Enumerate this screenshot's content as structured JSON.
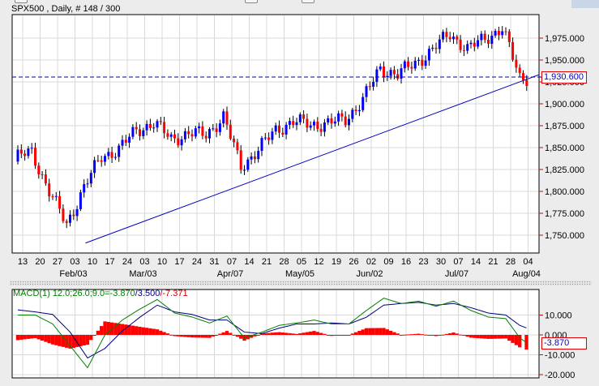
{
  "title": "SPX500 , Daily, # 148 / 300",
  "colors": {
    "up": "#0000ff",
    "down": "#ff0000",
    "macd": "#008000",
    "signal": "#000080",
    "histogram": "#ff0000",
    "trendline": "#0000c0"
  },
  "chart_data": [
    {
      "type": "candlestick",
      "symbol": "SPX500",
      "timeframe": "Daily",
      "ylim": [
        1729,
        2002
      ],
      "y_ticks": [
        "1,975.000",
        "1,950.000",
        "1,925.000",
        "1,900.000",
        "1,875.000",
        "1,850.000",
        "1,825.000",
        "1,800.000",
        "1,775.000",
        "1,750.000"
      ],
      "y_tick_values": [
        1975,
        1950,
        1925,
        1900,
        1875,
        1850,
        1825,
        1800,
        1775,
        1750
      ],
      "x_ticks": [
        "13",
        "20",
        "27",
        "03",
        "10",
        "17",
        "24",
        "03",
        "10",
        "17",
        "24",
        "31",
        "07",
        "14",
        "21",
        "28",
        "05",
        "12",
        "19",
        "26",
        "02",
        "09",
        "16",
        "23",
        "30",
        "07",
        "14",
        "21",
        "28",
        "04"
      ],
      "month_labels": [
        {
          "label": "Feb/03",
          "week": 3
        },
        {
          "label": "Mar/03",
          "week": 7
        },
        {
          "label": "Apr/07",
          "week": 12
        },
        {
          "label": "May/05",
          "week": 16
        },
        {
          "label": "Jun/02",
          "week": 20
        },
        {
          "label": "Jul/07",
          "week": 25
        },
        {
          "label": "Aug/04",
          "week": 29
        }
      ],
      "weekly_closes": [
        1838,
        1845,
        1800,
        1762,
        1805,
        1840,
        1848,
        1870,
        1878,
        1860,
        1866,
        1865,
        1885,
        1828,
        1848,
        1870,
        1880,
        1876,
        1878,
        1882,
        1905,
        1940,
        1934,
        1946,
        1962,
        1980,
        1962,
        1975,
        1986,
        1930,
        1931
      ],
      "current_price": "1,930.600",
      "current_price_value": 1930.6,
      "trendline": {
        "from": {
          "week": 3.6,
          "value": 1741
        },
        "to": {
          "week": 29.6,
          "value": 1933
        }
      }
    },
    {
      "type": "line",
      "title": "MACD(1) 12.0;26.0;9.0",
      "legend_macd": "MACD(1) 12.0;26.0;9.0=-3.870",
      "legend_signal": "/3.500",
      "legend_hist": "/-7.371",
      "current_value": "-3.870",
      "ylim": [
        -21,
        21
      ],
      "y_ticks": [
        "10.000",
        "0.000",
        "-10.000",
        "-20.000"
      ],
      "y_tick_values": [
        10,
        0,
        -10,
        -20
      ],
      "series": [
        {
          "name": "MACD",
          "values": [
            10,
            10,
            5.5,
            -5.5,
            -16.5,
            0,
            7.5,
            13,
            17.8,
            11,
            9,
            6,
            9.5,
            -1.5,
            1.4,
            4.8,
            6,
            7.5,
            5.5,
            5.5,
            12.3,
            18.5,
            15.8,
            17,
            14.4,
            17,
            12.3,
            9,
            8.2,
            -3.87
          ]
        },
        {
          "name": "Signal",
          "values": [
            12.6,
            11.6,
            10.3,
            1.4,
            -11.6,
            -6.8,
            2,
            8.9,
            15,
            11.6,
            10.3,
            7.5,
            7.5,
            1.4,
            0.7,
            3.4,
            5.5,
            5.5,
            6,
            5.5,
            8.9,
            15,
            15.8,
            16.4,
            15,
            15.8,
            13.7,
            11,
            10,
            3.5
          ]
        }
      ]
    }
  ]
}
